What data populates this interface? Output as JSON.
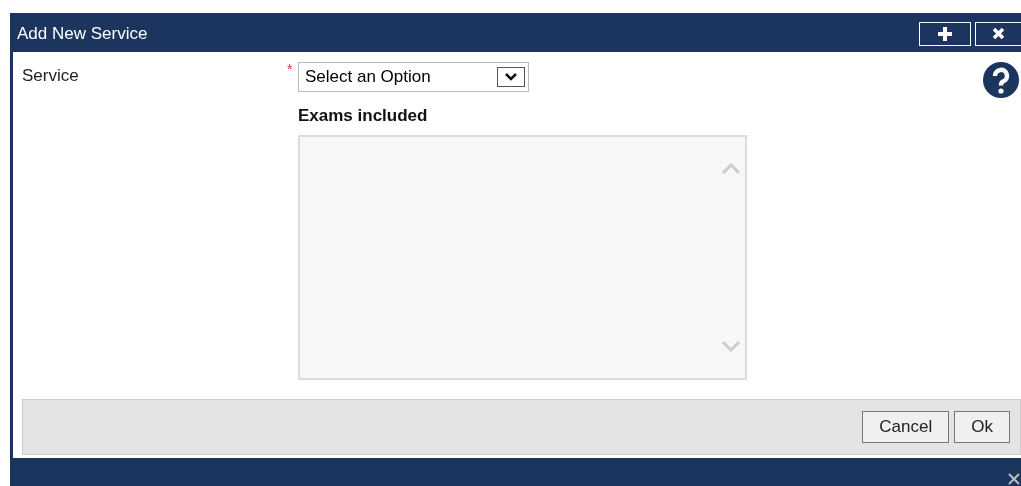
{
  "window": {
    "title": "Add New Service"
  },
  "form": {
    "label": "Service",
    "required_mark": "*",
    "select": {
      "value": "Select an Option"
    },
    "list_label": "Exams included"
  },
  "buttons": [
    "Cancel",
    "Ok"
  ]
}
